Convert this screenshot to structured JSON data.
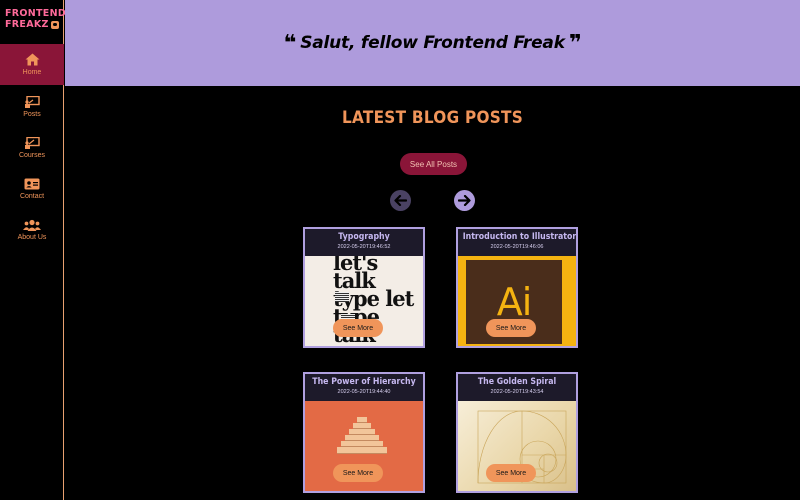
{
  "brand": {
    "line1": "FRONTEND",
    "line2": "FREAKZ"
  },
  "nav": [
    {
      "label": "Home",
      "icon": "home-icon",
      "active": true
    },
    {
      "label": "Posts",
      "icon": "presentation-icon"
    },
    {
      "label": "Courses",
      "icon": "teacher-board-icon"
    },
    {
      "label": "Contact",
      "icon": "contact-card-icon"
    },
    {
      "label": "About Us",
      "icon": "users-icon"
    }
  ],
  "header": {
    "quote": "Salut, fellow Frontend Freak"
  },
  "section": {
    "title": "LATEST BLOG POSTS",
    "see_all": "See All Posts"
  },
  "posts": [
    {
      "title": "Typography",
      "date": "2022-05-20T19:46:52",
      "button": "See More",
      "image_text": "let's talk type let type talk"
    },
    {
      "title": "Introduction to Illustrator",
      "date": "2022-05-20T19:46:06",
      "button": "See More",
      "image_text": "Ai"
    },
    {
      "title": "The Power of Hierarchy",
      "date": "2022-05-20T19:44:40",
      "button": "See More"
    },
    {
      "title": "The Golden Spiral",
      "date": "2022-05-20T19:43:54",
      "button": "See More"
    }
  ],
  "colors": {
    "accent_orange": "#f0955a",
    "accent_purple": "#ae9bdc",
    "accent_crimson": "#8a1538",
    "background": "#000000"
  }
}
